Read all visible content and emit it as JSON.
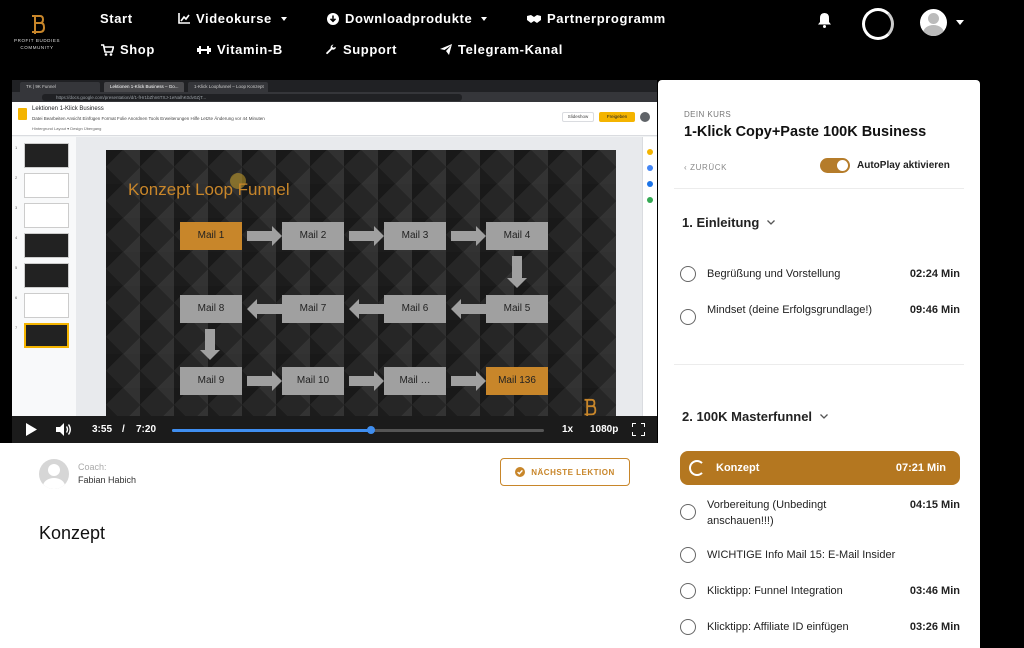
{
  "nav": {
    "logo_text": "PROFIT BUDDIES",
    "logo_sub": "COMMUNITY",
    "items": [
      {
        "label": "Start",
        "icon": "none"
      },
      {
        "label": "Videokurse",
        "icon": "chart-icon",
        "dropdown": true
      },
      {
        "label": "Downloadprodukte",
        "icon": "download-icon",
        "dropdown": true
      },
      {
        "label": "Partnerprogramm",
        "icon": "handshake-icon"
      },
      {
        "label": "Shop",
        "icon": "cart-icon"
      },
      {
        "label": "Vitamin-B",
        "icon": "dumbbell-icon"
      },
      {
        "label": "Support",
        "icon": "wrench-icon"
      },
      {
        "label": "Telegram-Kanal",
        "icon": "paper-plane-icon"
      }
    ]
  },
  "browser": {
    "tabs": [
      "TK | 9K Funnel",
      "Lektionen 1-Klick Business – Go...",
      "1-Klick Loopfunnel – Loop Konzept"
    ],
    "url": "https://docs.google.com/presentation/d/1-fHr1bZhn6TXJ-1eNalhK0dv0ZjT..."
  },
  "slides_app": {
    "doc_title": "Lektionen 1-Klick Business",
    "menu": "Datei  Bearbeiten  Ansicht  Einfügen  Format  Folie  Anordnen  Tools  Erweiterungen  Hilfe  Letzte Änderung vor 44 Minuten",
    "toolbar": "Hintergrund   Layout ▾   Design   Übergang",
    "slideshow": "Slideshow",
    "share": "Freigeben",
    "thumb_numbers": [
      "1",
      "2",
      "3",
      "4",
      "5",
      "6",
      "7"
    ]
  },
  "slide": {
    "title": "Konzept Loop Funnel",
    "mails": [
      "Mail 1",
      "Mail 2",
      "Mail 3",
      "Mail 4",
      "Mail 5",
      "Mail 6",
      "Mail 7",
      "Mail 8",
      "Mail 9",
      "Mail 10",
      "Mail …",
      "Mail 136"
    ]
  },
  "player": {
    "current_time": "3:55",
    "separator": "/",
    "duration": "7:20",
    "progress_fraction": 0.534,
    "speed": "1x",
    "quality": "1080p"
  },
  "coach": {
    "label": "Coach:",
    "name": "Fabian Habich"
  },
  "next_button": "NÄCHSTE LEKTION",
  "lesson_title": "Konzept",
  "panel": {
    "kurs_label": "DEIN KURS",
    "kurs_title": "1-Klick Copy+Paste 100K Business",
    "back_label": "ZURÜCK",
    "autoplay_label": "AutoPlay aktivieren",
    "autoplay_on": true,
    "sections": [
      {
        "title": "1. Einleitung",
        "lessons": [
          {
            "title": "Begrüßung und Vorstellung",
            "duration": "02:24 Min"
          },
          {
            "title": "Mindset (deine Erfolgsgrundlage!)",
            "duration": "09:46 Min"
          }
        ]
      },
      {
        "title": "2. 100K Masterfunnel",
        "lessons": [
          {
            "title": "Konzept",
            "duration": "07:21 Min",
            "active": true
          },
          {
            "title": "Vorbereitung (Unbedingt anschauen!!!)",
            "duration": "04:15 Min"
          },
          {
            "title": "WICHTIGE Info Mail 15: E-Mail Insider",
            "duration": ""
          },
          {
            "title": "Klicktipp: Funnel Integration",
            "duration": "03:46 Min"
          },
          {
            "title": "Klicktipp: Affiliate ID einfügen",
            "duration": "03:26 Min"
          }
        ]
      }
    ]
  },
  "colors": {
    "accent": "#b47720",
    "slide_orange": "#c8862a",
    "progress_blue": "#3f8ef0"
  }
}
